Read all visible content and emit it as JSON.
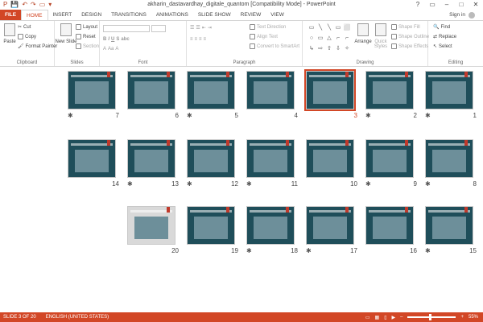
{
  "window": {
    "title": "akharin_dastavardhay_digitale_quantom [Compatibility Mode] - PowerPoint",
    "controls": [
      "?",
      "▭",
      "–",
      "□",
      "✕"
    ]
  },
  "qat": [
    "P",
    "💾",
    "↶",
    "↷",
    "▭",
    "▾"
  ],
  "tabs": [
    {
      "label": "FILE"
    },
    {
      "label": "HOME"
    },
    {
      "label": "INSERT"
    },
    {
      "label": "DESIGN"
    },
    {
      "label": "TRANSITIONS"
    },
    {
      "label": "ANIMATIONS"
    },
    {
      "label": "SLIDE SHOW"
    },
    {
      "label": "REVIEW"
    },
    {
      "label": "VIEW"
    }
  ],
  "account": {
    "sign_in": "Sign in"
  },
  "ribbon": {
    "clipboard": {
      "label": "Clipboard",
      "paste": "Paste",
      "cut": "Cut",
      "copy": "Copy",
      "format_painter": "Format Painter"
    },
    "slides": {
      "label": "Slides",
      "new_slide": "New Slide",
      "layout": "Layout",
      "reset": "Reset",
      "section": "Section"
    },
    "font": {
      "label": "Font"
    },
    "paragraph": {
      "label": "Paragraph",
      "text_direction": "Text Direction",
      "align_text": "Align Text",
      "convert": "Convert to SmartArt"
    },
    "drawing": {
      "label": "Drawing",
      "arrange": "Arrange",
      "quick_styles": "Quick Styles",
      "shape_fill": "Shape Fill",
      "shape_outline": "Shape Outline",
      "shape_effects": "Shape Effects"
    },
    "editing": {
      "label": "Editing",
      "find": "Find",
      "replace": "Replace",
      "select": "Select"
    }
  },
  "shapes": [
    "▭",
    "╲",
    "╲",
    "▭",
    "⬜",
    "○",
    "▭",
    "△",
    "⌐",
    "⌐",
    "↳",
    "⇨",
    "⇧",
    "⇩",
    "✧"
  ],
  "slides": [
    {
      "num": "7",
      "star": "✱"
    },
    {
      "num": "6",
      "star": ""
    },
    {
      "num": "5",
      "star": "✱"
    },
    {
      "num": "4",
      "star": ""
    },
    {
      "num": "3",
      "star": "",
      "selected": true
    },
    {
      "num": "2",
      "star": "✱"
    },
    {
      "num": "1",
      "star": "✱"
    },
    {
      "num": "14",
      "star": ""
    },
    {
      "num": "13",
      "star": "✱"
    },
    {
      "num": "12",
      "star": "✱"
    },
    {
      "num": "11",
      "star": "✱"
    },
    {
      "num": "10",
      "star": ""
    },
    {
      "num": "9",
      "star": "✱"
    },
    {
      "num": "8",
      "star": "✱"
    },
    {
      "num": "20",
      "star": ""
    },
    {
      "num": "19",
      "star": ""
    },
    {
      "num": "18",
      "star": "✱"
    },
    {
      "num": "17",
      "star": "✱"
    },
    {
      "num": "16",
      "star": ""
    },
    {
      "num": "15",
      "star": "✱"
    }
  ],
  "status": {
    "slide_info": "SLIDE 3 OF 20",
    "language": "ENGLISH (UNITED STATES)",
    "zoom": "55%"
  },
  "colors": {
    "accent": "#d24726",
    "slide_bg": "#1f4e5a"
  }
}
